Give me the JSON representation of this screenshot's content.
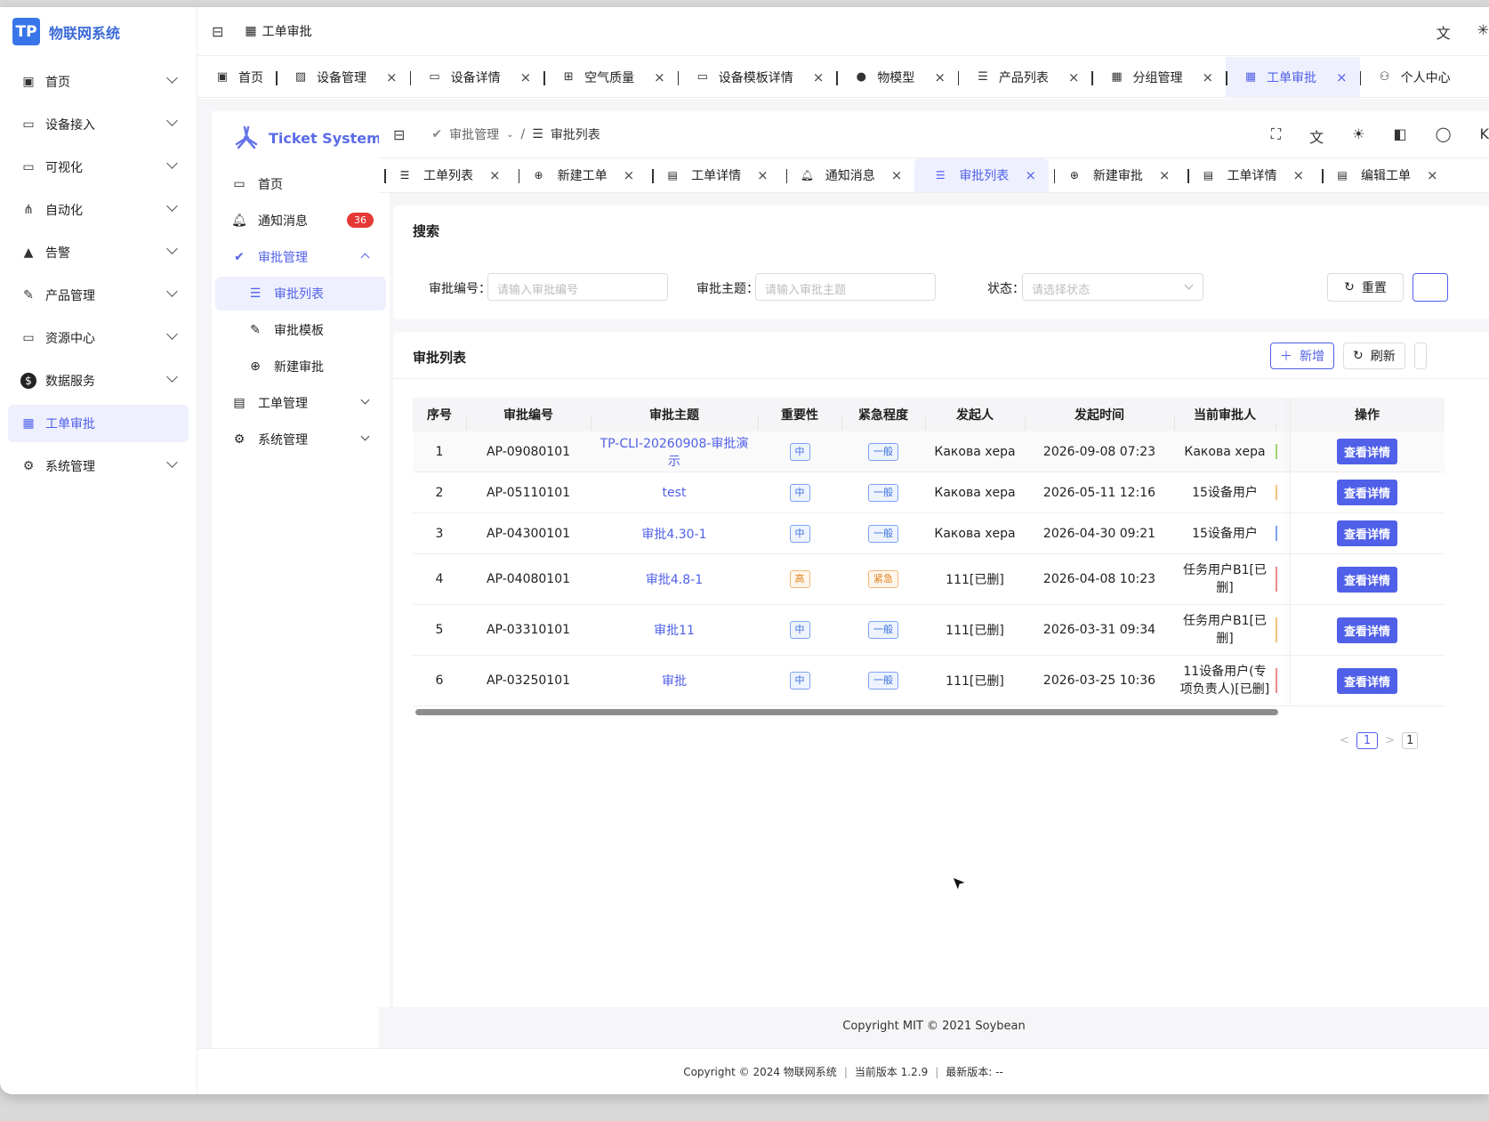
{
  "app": {
    "logo_letters": "TP",
    "title": "物联网系统"
  },
  "outer_menu": [
    {
      "label": "首页",
      "icon": "home-icon"
    },
    {
      "label": "设备接入",
      "icon": "monitor-icon"
    },
    {
      "label": "可视化",
      "icon": "screen-icon"
    },
    {
      "label": "自动化",
      "icon": "flow-icon"
    },
    {
      "label": "告警",
      "icon": "warning-icon"
    },
    {
      "label": "产品管理",
      "icon": "edit-doc-icon"
    },
    {
      "label": "资源中心",
      "icon": "screen-icon"
    },
    {
      "label": "数据服务",
      "icon": "dollar-circle-icon"
    },
    {
      "label": "工单审批",
      "icon": "ticket-icon",
      "active": true
    },
    {
      "label": "系统管理",
      "icon": "settings-screen-icon"
    }
  ],
  "outer_header": {
    "breadcrumb": "工单审批"
  },
  "outer_tabs": [
    {
      "label": "首页",
      "closable": false
    },
    {
      "label": "设备管理",
      "closable": true
    },
    {
      "label": "设备详情",
      "closable": true
    },
    {
      "label": "空气质量",
      "closable": true
    },
    {
      "label": "设备模板详情",
      "closable": true
    },
    {
      "label": "物模型",
      "closable": true
    },
    {
      "label": "产品列表",
      "closable": true
    },
    {
      "label": "分组管理",
      "closable": true
    },
    {
      "label": "工单审批",
      "closable": true,
      "active": true
    },
    {
      "label": "个人中心",
      "closable": false
    }
  ],
  "inner_app": {
    "title": "Ticket System"
  },
  "inner_menu": {
    "home": "首页",
    "notifications": "通知消息",
    "notification_count": "36",
    "approval_group": "审批管理",
    "approval_list": "审批列表",
    "approval_template": "审批模板",
    "new_approval": "新建审批",
    "ticket_group": "工单管理",
    "system_group": "系统管理"
  },
  "inner_header": {
    "crumb_parent": "审批管理",
    "crumb_current": "审批列表",
    "right_edge_text": "K"
  },
  "inner_tabs": [
    {
      "label": "工单列表"
    },
    {
      "label": "新建工单"
    },
    {
      "label": "工单详情"
    },
    {
      "label": "通知消息"
    },
    {
      "label": "审批列表",
      "active": true
    },
    {
      "label": "新建审批"
    },
    {
      "label": "工单详情"
    },
    {
      "label": "编辑工单"
    }
  ],
  "search": {
    "title": "搜索",
    "code_label": "审批编号",
    "code_placeholder": "请输入审批编号",
    "subject_label": "审批主题",
    "subject_placeholder": "请输入审批主题",
    "status_label": "状态",
    "status_placeholder": "请选择状态",
    "reset_label": "重置"
  },
  "table": {
    "title": "审批列表",
    "add_label": "新增",
    "refresh_label": "刷新",
    "columns": [
      "序号",
      "审批编号",
      "审批主题",
      "重要性",
      "紧急程度",
      "发起人",
      "发起时间",
      "当前审批人",
      "",
      "操作"
    ],
    "rows": [
      {
        "no": "1",
        "code": "AP-09080101",
        "subject": "TP-CLI-20260908-审批演示",
        "importance": "中",
        "urgency": "一般",
        "initiator": "Какова хера",
        "time": "2026-09-08 07:23",
        "approver": "Какова хера",
        "action": "查看详情",
        "strip_color": "#a3d36a"
      },
      {
        "no": "2",
        "code": "AP-05110101",
        "subject": "test",
        "importance": "中",
        "urgency": "一般",
        "initiator": "Какова хера",
        "time": "2026-05-11 12:16",
        "approver": "15设备用户",
        "action": "查看详情",
        "strip_color": "#f4c27a"
      },
      {
        "no": "3",
        "code": "AP-04300101",
        "subject": "审批4.30-1",
        "importance": "中",
        "urgency": "一般",
        "initiator": "Какова хера",
        "time": "2026-04-30 09:21",
        "approver": "15设备用户",
        "action": "查看详情",
        "strip_color": "#7ea2f2"
      },
      {
        "no": "4",
        "code": "AP-04080101",
        "subject": "审批4.8-1",
        "importance": "高",
        "urgency": "紧急",
        "initiator": "111[已删]",
        "time": "2026-04-08 10:23",
        "approver": "任务用户B1[已删]",
        "action": "查看详情",
        "strip_color": "#f08a8a"
      },
      {
        "no": "5",
        "code": "AP-03310101",
        "subject": "审批11",
        "importance": "中",
        "urgency": "一般",
        "initiator": "111[已删]",
        "time": "2026-03-31 09:34",
        "approver": "任务用户B1[已删]",
        "action": "查看详情",
        "strip_color": "#f4c27a"
      },
      {
        "no": "6",
        "code": "AP-03250101",
        "subject": "审批",
        "importance": "中",
        "urgency": "一般",
        "initiator": "111[已删]",
        "time": "2026-03-25 10:36",
        "approver": "11设备用户(专项负责人)[已删]",
        "action": "查看详情",
        "strip_color": "#f08a8a"
      }
    ]
  },
  "pagination": {
    "prev": "<",
    "current": "1",
    "next": ">",
    "edge": "1"
  },
  "inner_footer": "Copyright MIT © 2021 Soybean",
  "outer_footer": {
    "copyright": "Copyright © 2024 物联网系统",
    "current_version": "当前版本 1.2.9",
    "latest_version": "最新版本: --"
  }
}
